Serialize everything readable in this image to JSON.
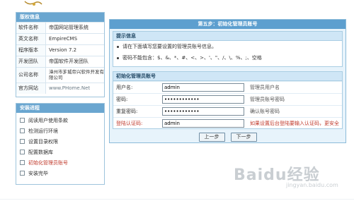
{
  "version_info": {
    "title": "版权信息",
    "rows": [
      {
        "key": "软件名称",
        "value": "帝国网站管理系统"
      },
      {
        "key": "英文名称",
        "value": "EmpireCMS"
      },
      {
        "key": "程序版本",
        "value": "Version 7.2"
      },
      {
        "key": "开发团队",
        "value": "帝国软件开发团队"
      },
      {
        "key": "公司名称",
        "value": "漳州市芗城帝兴软件开发有限公司"
      },
      {
        "key": "官方网站",
        "value": "www.PHome.Net"
      }
    ]
  },
  "steps": {
    "title": "安装进程",
    "items": [
      {
        "label": "阅读用户使用条款"
      },
      {
        "label": "检测运行环境"
      },
      {
        "label": "设置目录权限"
      },
      {
        "label": "配置数据库"
      },
      {
        "label": "初始化管理员账号"
      },
      {
        "label": "安装完毕"
      }
    ]
  },
  "main": {
    "title": "第五步：初始化管理员账号",
    "tips": {
      "title": "提示信息",
      "items": [
        "请在下面填写您要设置的管理员账号信息。",
        "密码不能包含：$、&、*、#、<、>、'、\"、/、\\、%、;、空格"
      ]
    },
    "form": {
      "title": "初始化管理员账号",
      "rows": [
        {
          "label": "用户名:",
          "value": "admin",
          "hint": "管理员用户名"
        },
        {
          "label": "密码:",
          "value": "••••••••••••",
          "hint": "管理员账号密码"
        },
        {
          "label": "重复密码:",
          "value": "••••••••••••",
          "hint": "确认账号密码"
        },
        {
          "label": "登陆认证码:",
          "value": "admin",
          "hint": "如果设置后台登陆要输入认证码，更安全"
        }
      ]
    },
    "buttons": {
      "prev": "上一步",
      "next": "下一步"
    }
  },
  "watermark": {
    "logo": "Baidu经验",
    "url": "jingyan.baidu.com"
  },
  "colors": {
    "accent": "#5d9fcf",
    "header": "#6aa6d0",
    "panel_bg": "#e7f3fb",
    "warning": "#c0392b"
  }
}
